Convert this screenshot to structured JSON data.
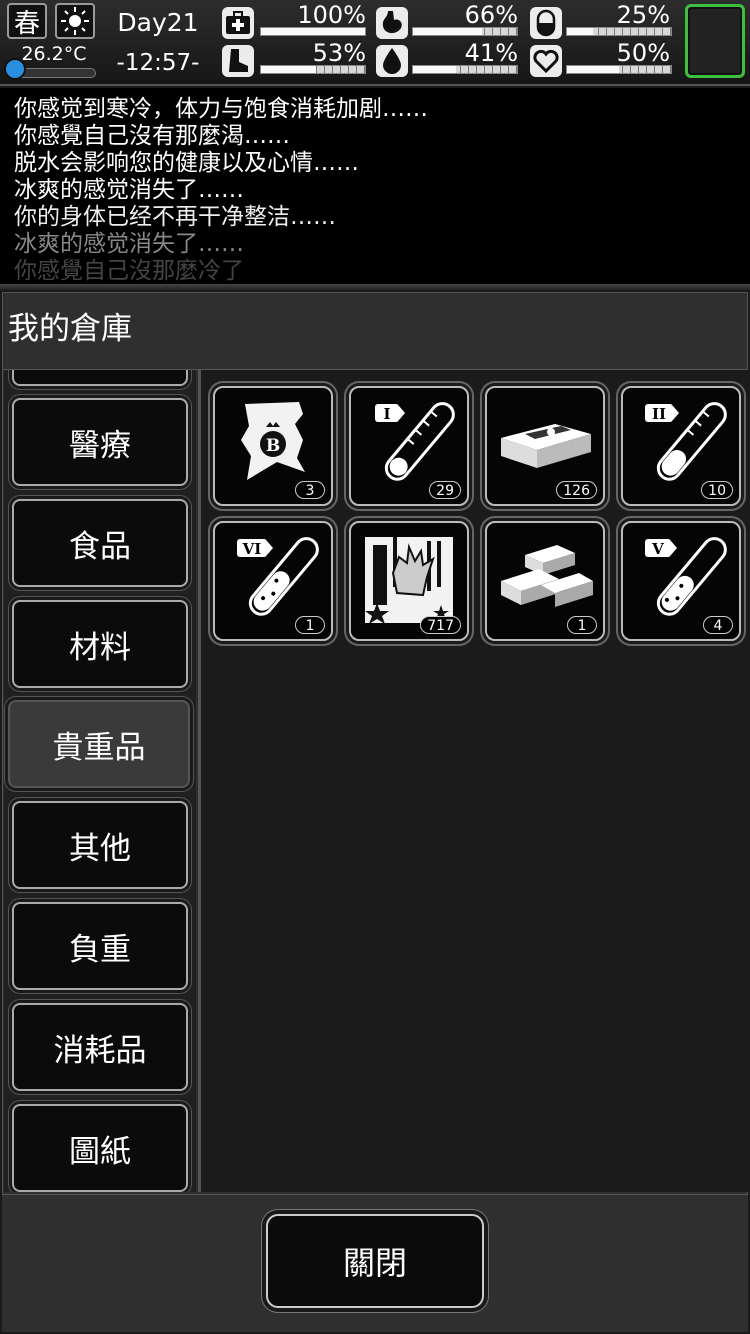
{
  "status": {
    "season": "春",
    "temperature": "26.2°C",
    "temperature_level": 0.12,
    "day": "Day21",
    "time": "-12:57-",
    "stats": [
      {
        "icon": "medkit-icon",
        "value": "100%",
        "level": 1.0
      },
      {
        "icon": "stomach-icon",
        "value": "66%",
        "level": 0.66
      },
      {
        "icon": "pill-icon",
        "value": "25%",
        "level": 0.25
      },
      {
        "icon": "boot-icon",
        "value": "53%",
        "level": 0.53
      },
      {
        "icon": "water-drop-icon",
        "value": "41%",
        "level": 0.41
      },
      {
        "icon": "heart-icon",
        "value": "50%",
        "level": 0.5
      }
    ],
    "accent": "#3fbf3f"
  },
  "log": [
    "你感觉到寒冷，体力与饱食消耗加剧……",
    "你感覺自己沒有那麼渴……",
    "脱水会影响您的健康以及心情……",
    "冰爽的感觉消失了……",
    "你的身体已经不再干净整洁……",
    "冰爽的感觉消失了……",
    "你感覺自己沒那麼冷了"
  ],
  "panel": {
    "title": "我的倉庫",
    "tabs": [
      "醫療",
      "食品",
      "材料",
      "貴重品",
      "其他",
      "負重",
      "消耗品",
      "圖紙"
    ],
    "selected_tab": "貴重品",
    "items": [
      {
        "icon": "bitcoin-paper-icon",
        "count": "3"
      },
      {
        "icon": "test-tube-1-icon",
        "count": "29"
      },
      {
        "icon": "banknote-bundle-icon",
        "count": "126"
      },
      {
        "icon": "test-tube-2-icon",
        "count": "10"
      },
      {
        "icon": "test-tube-6-icon",
        "count": "1"
      },
      {
        "icon": "zombie-hand-card-icon",
        "count": "717"
      },
      {
        "icon": "gold-bars-icon",
        "count": "1"
      },
      {
        "icon": "test-tube-5-icon",
        "count": "4"
      }
    ],
    "close_label": "關閉"
  }
}
